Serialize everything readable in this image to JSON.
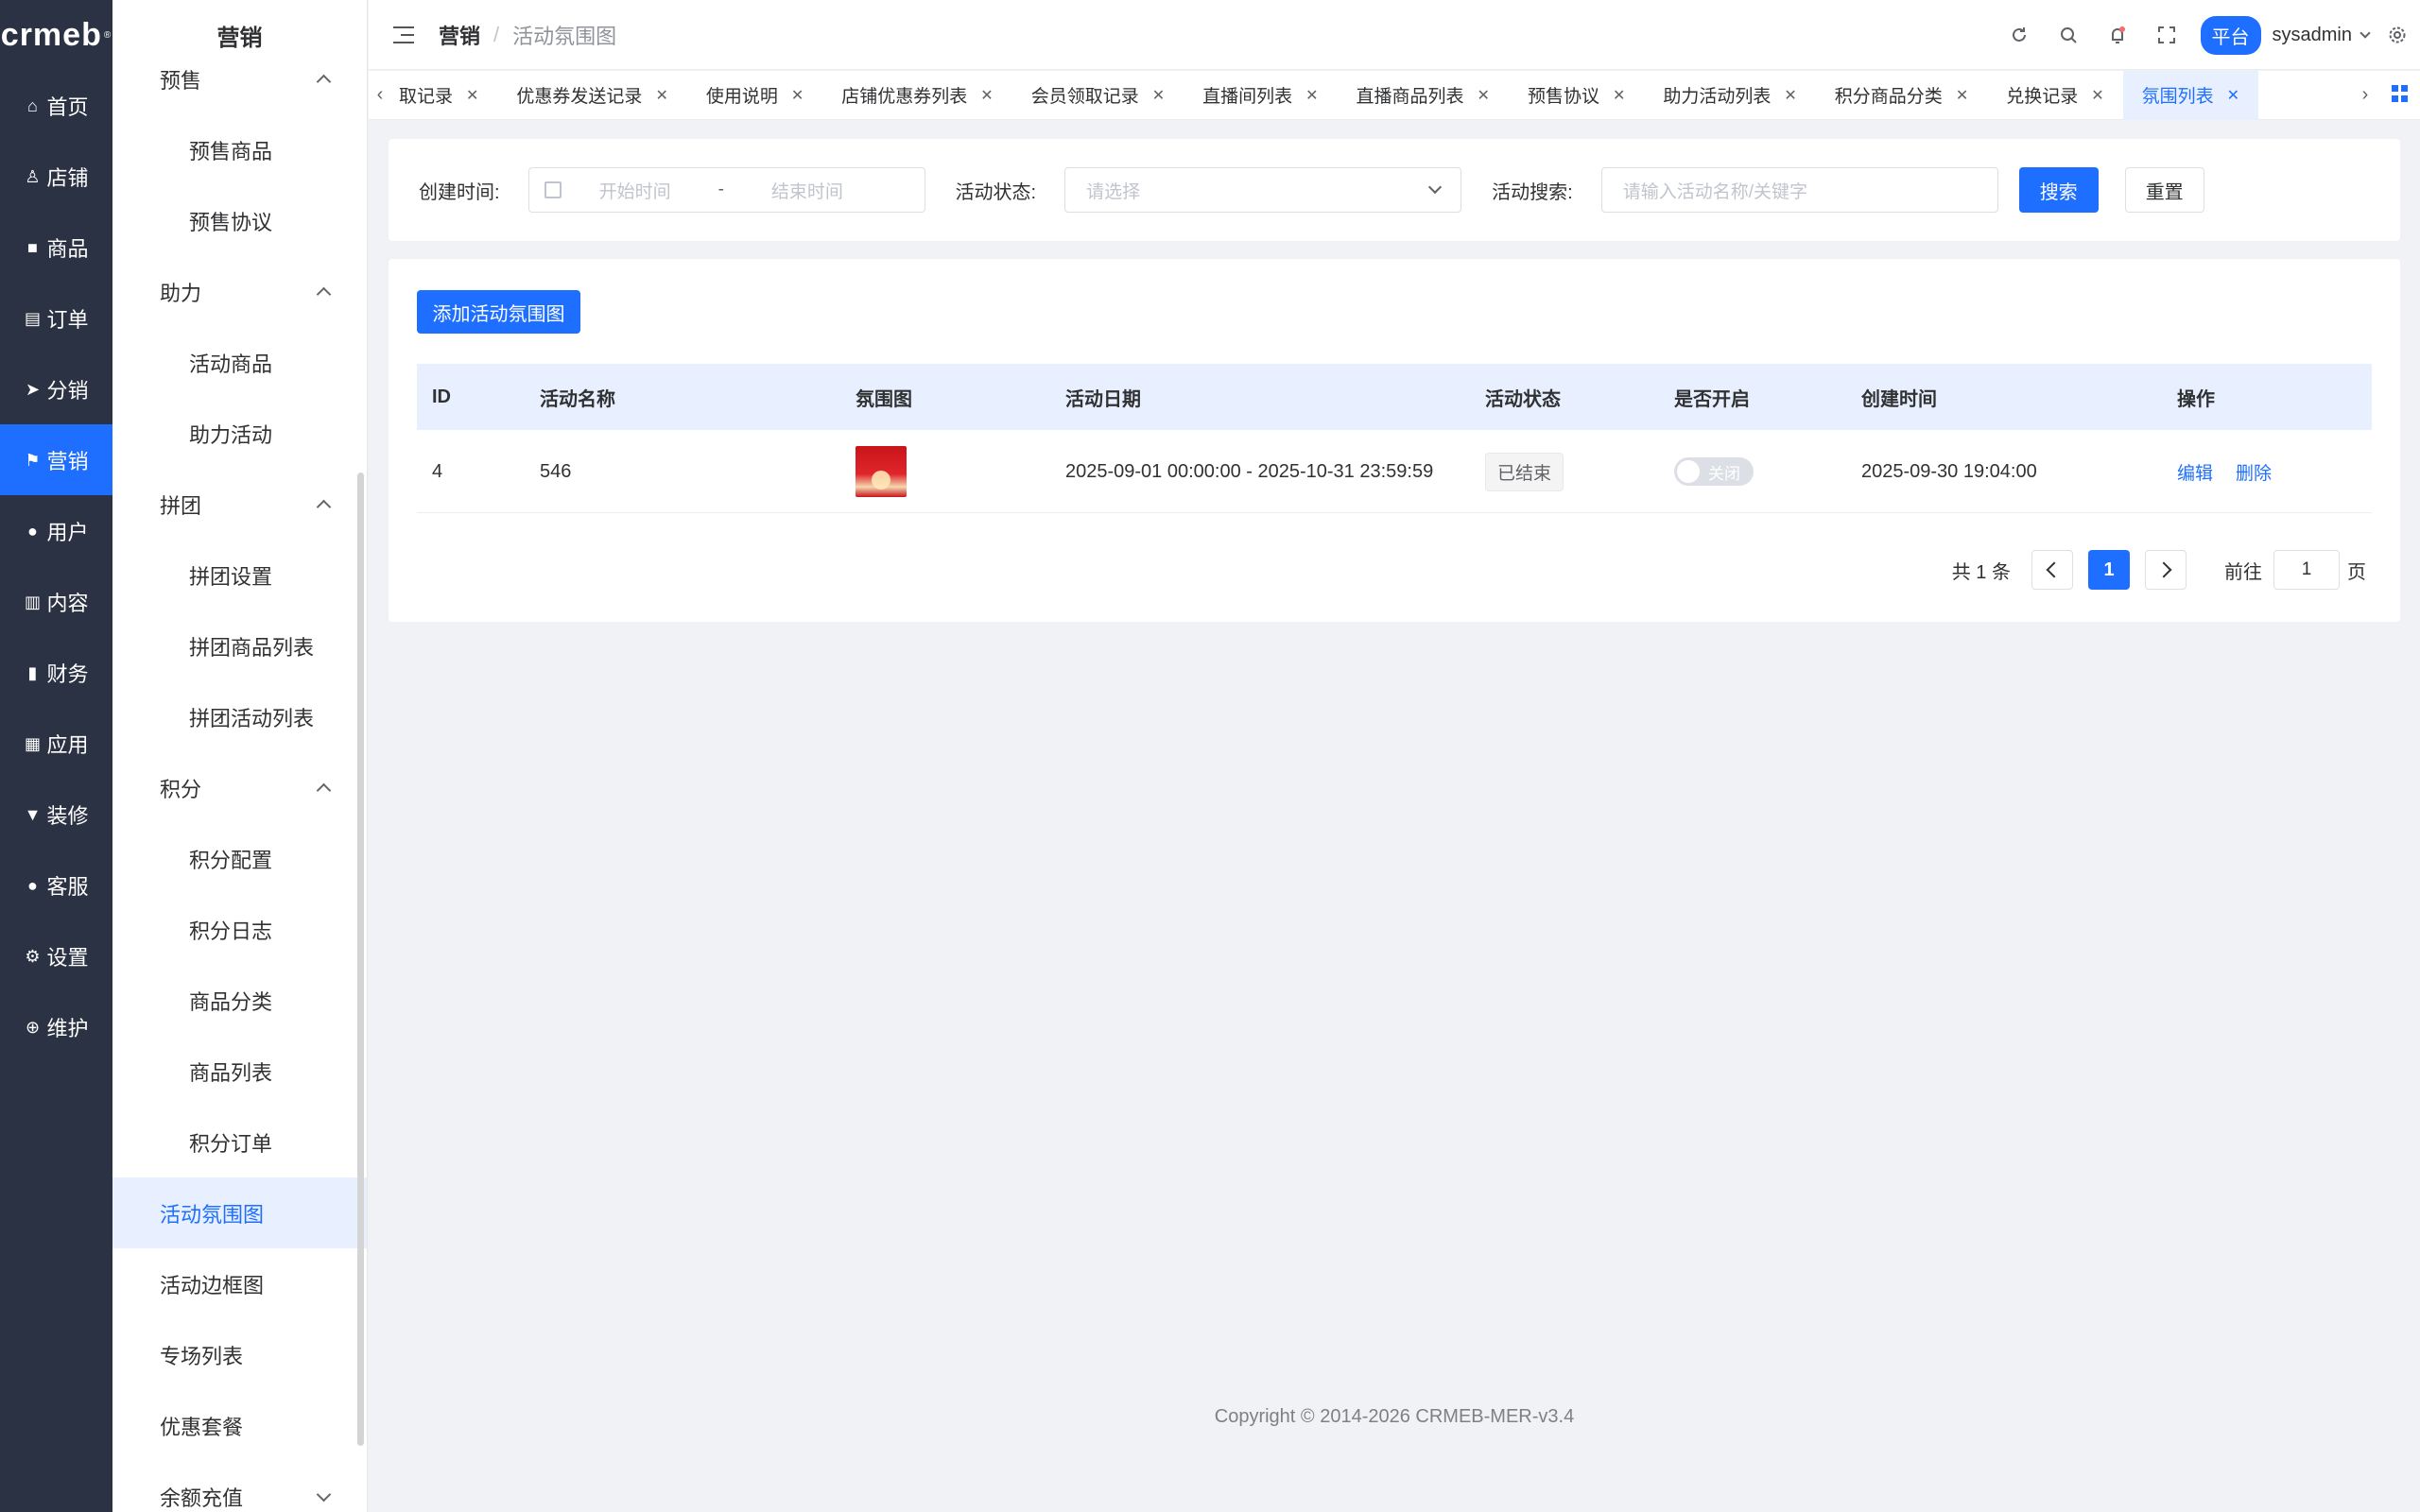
{
  "app": {
    "logo": "crmeb",
    "logo_mark": "®"
  },
  "nav1": [
    {
      "label": "首页",
      "icon": "home-icon",
      "glyph": "⌂"
    },
    {
      "label": "店铺",
      "icon": "user-outline-icon",
      "glyph": "♙"
    },
    {
      "label": "商品",
      "icon": "bag-icon",
      "glyph": "■"
    },
    {
      "label": "订单",
      "icon": "clipboard-icon",
      "glyph": "▤"
    },
    {
      "label": "分销",
      "icon": "send-icon",
      "glyph": "➤"
    },
    {
      "label": "营销",
      "icon": "flag-icon",
      "glyph": "⚑"
    },
    {
      "label": "用户",
      "icon": "user-icon",
      "glyph": "●"
    },
    {
      "label": "内容",
      "icon": "book-icon",
      "glyph": "▥"
    },
    {
      "label": "财务",
      "icon": "bar-chart-icon",
      "glyph": "▮"
    },
    {
      "label": "应用",
      "icon": "grid-icon",
      "glyph": "▦"
    },
    {
      "label": "装修",
      "icon": "paint-icon",
      "glyph": "▼"
    },
    {
      "label": "客服",
      "icon": "service-icon",
      "glyph": "●"
    },
    {
      "label": "设置",
      "icon": "gear-icon",
      "glyph": "⚙"
    },
    {
      "label": "维护",
      "icon": "plus-circle-icon",
      "glyph": "⊕"
    }
  ],
  "nav2": {
    "title": "营销",
    "presale": {
      "label": "预售",
      "items": [
        "预售商品",
        "预售协议"
      ]
    },
    "assist": {
      "label": "助力",
      "items": [
        "活动商品",
        "助力活动"
      ]
    },
    "group": {
      "label": "拼团",
      "items": [
        "拼团设置",
        "拼团商品列表",
        "拼团活动列表"
      ]
    },
    "points": {
      "label": "积分",
      "items": [
        "积分配置",
        "积分日志",
        "商品分类",
        "商品列表",
        "积分订单"
      ]
    },
    "top": [
      "活动氛围图",
      "活动边框图",
      "专场列表",
      "优惠套餐"
    ],
    "recharge": "余额充值"
  },
  "header": {
    "breadcrumb_main": "营销",
    "breadcrumb_sep": "/",
    "breadcrumb_current": "活动氛围图",
    "platform_badge": "平台",
    "username": "sysadmin"
  },
  "tabs": [
    "取记录",
    "优惠券发送记录",
    "使用说明",
    "店铺优惠券列表",
    "会员领取记录",
    "直播间列表",
    "直播商品列表",
    "预售协议",
    "助力活动列表",
    "积分商品分类",
    "兑换记录",
    "氛围列表"
  ],
  "filter": {
    "created_label": "创建时间:",
    "start_placeholder": "开始时间",
    "range_sep": "-",
    "end_placeholder": "结束时间",
    "status_label": "活动状态:",
    "status_placeholder": "请选择",
    "search_label": "活动搜索:",
    "search_placeholder": "请输入活动名称/关键字",
    "search_btn": "搜索",
    "reset_btn": "重置"
  },
  "table": {
    "add_btn": "添加活动氛围图",
    "columns": [
      "ID",
      "活动名称",
      "氛围图",
      "活动日期",
      "活动状态",
      "是否开启",
      "创建时间",
      "操作"
    ],
    "rows": [
      {
        "id": "4",
        "name": "546",
        "date": "2025-09-01 00:00:00 - 2025-10-31 23:59:59",
        "status": "已结束",
        "enabled_text": "关闭",
        "created": "2025-09-30 19:04:00",
        "edit": "编辑",
        "delete": "删除"
      }
    ]
  },
  "pager": {
    "total": "共 1 条",
    "current": "1",
    "goto_label": "前往",
    "goto_value": "1",
    "page_suffix": "页"
  },
  "footer": "Copyright © 2014-2026 CRMEB-MER-v3.4",
  "colors": {
    "accent": "#1e6fff",
    "nav_bg": "#2b3243",
    "header_row": "#e8f0ff"
  }
}
